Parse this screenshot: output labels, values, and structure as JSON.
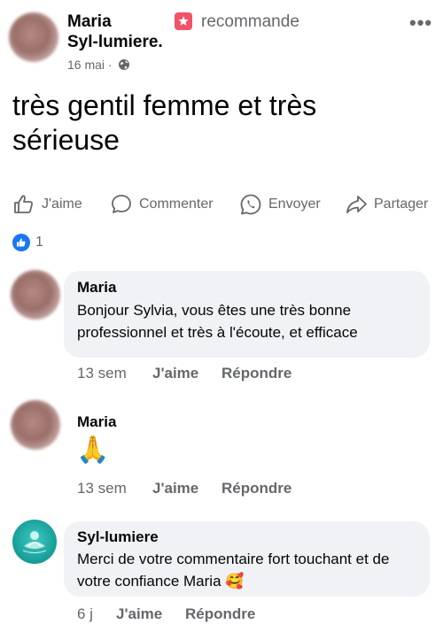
{
  "post": {
    "author_line1": "Maria",
    "author_line2": "Syl-lumiere.",
    "recommends": "recommande",
    "date": "16 mai ·",
    "text": "très gentil femme et très sérieuse",
    "actions": {
      "like": "J'aime",
      "comment": "Commenter",
      "send": "Envoyer",
      "share": "Partager"
    },
    "reaction_count": "1"
  },
  "comments": [
    {
      "name": "Maria",
      "text": "Bonjour Sylvia, vous êtes une très bonne professionnel et très à l'écoute, et efficace",
      "time": "13 sem",
      "like": "J'aime",
      "reply": "Répondre"
    },
    {
      "name": "Maria",
      "text": "🙏",
      "time": "13 sem",
      "like": "J'aime",
      "reply": "Répondre"
    },
    {
      "name": "Syl-lumiere",
      "text": "Merci de votre commentaire fort touchant et de votre confiance Maria 🥰",
      "time": "6 j",
      "like": "J'aime",
      "reply": "Répondre"
    }
  ],
  "colors": {
    "accent": "#1877f2",
    "recommend": "#f25268",
    "secondary_text": "#65676b",
    "bubble_bg": "#f0f2f5"
  }
}
